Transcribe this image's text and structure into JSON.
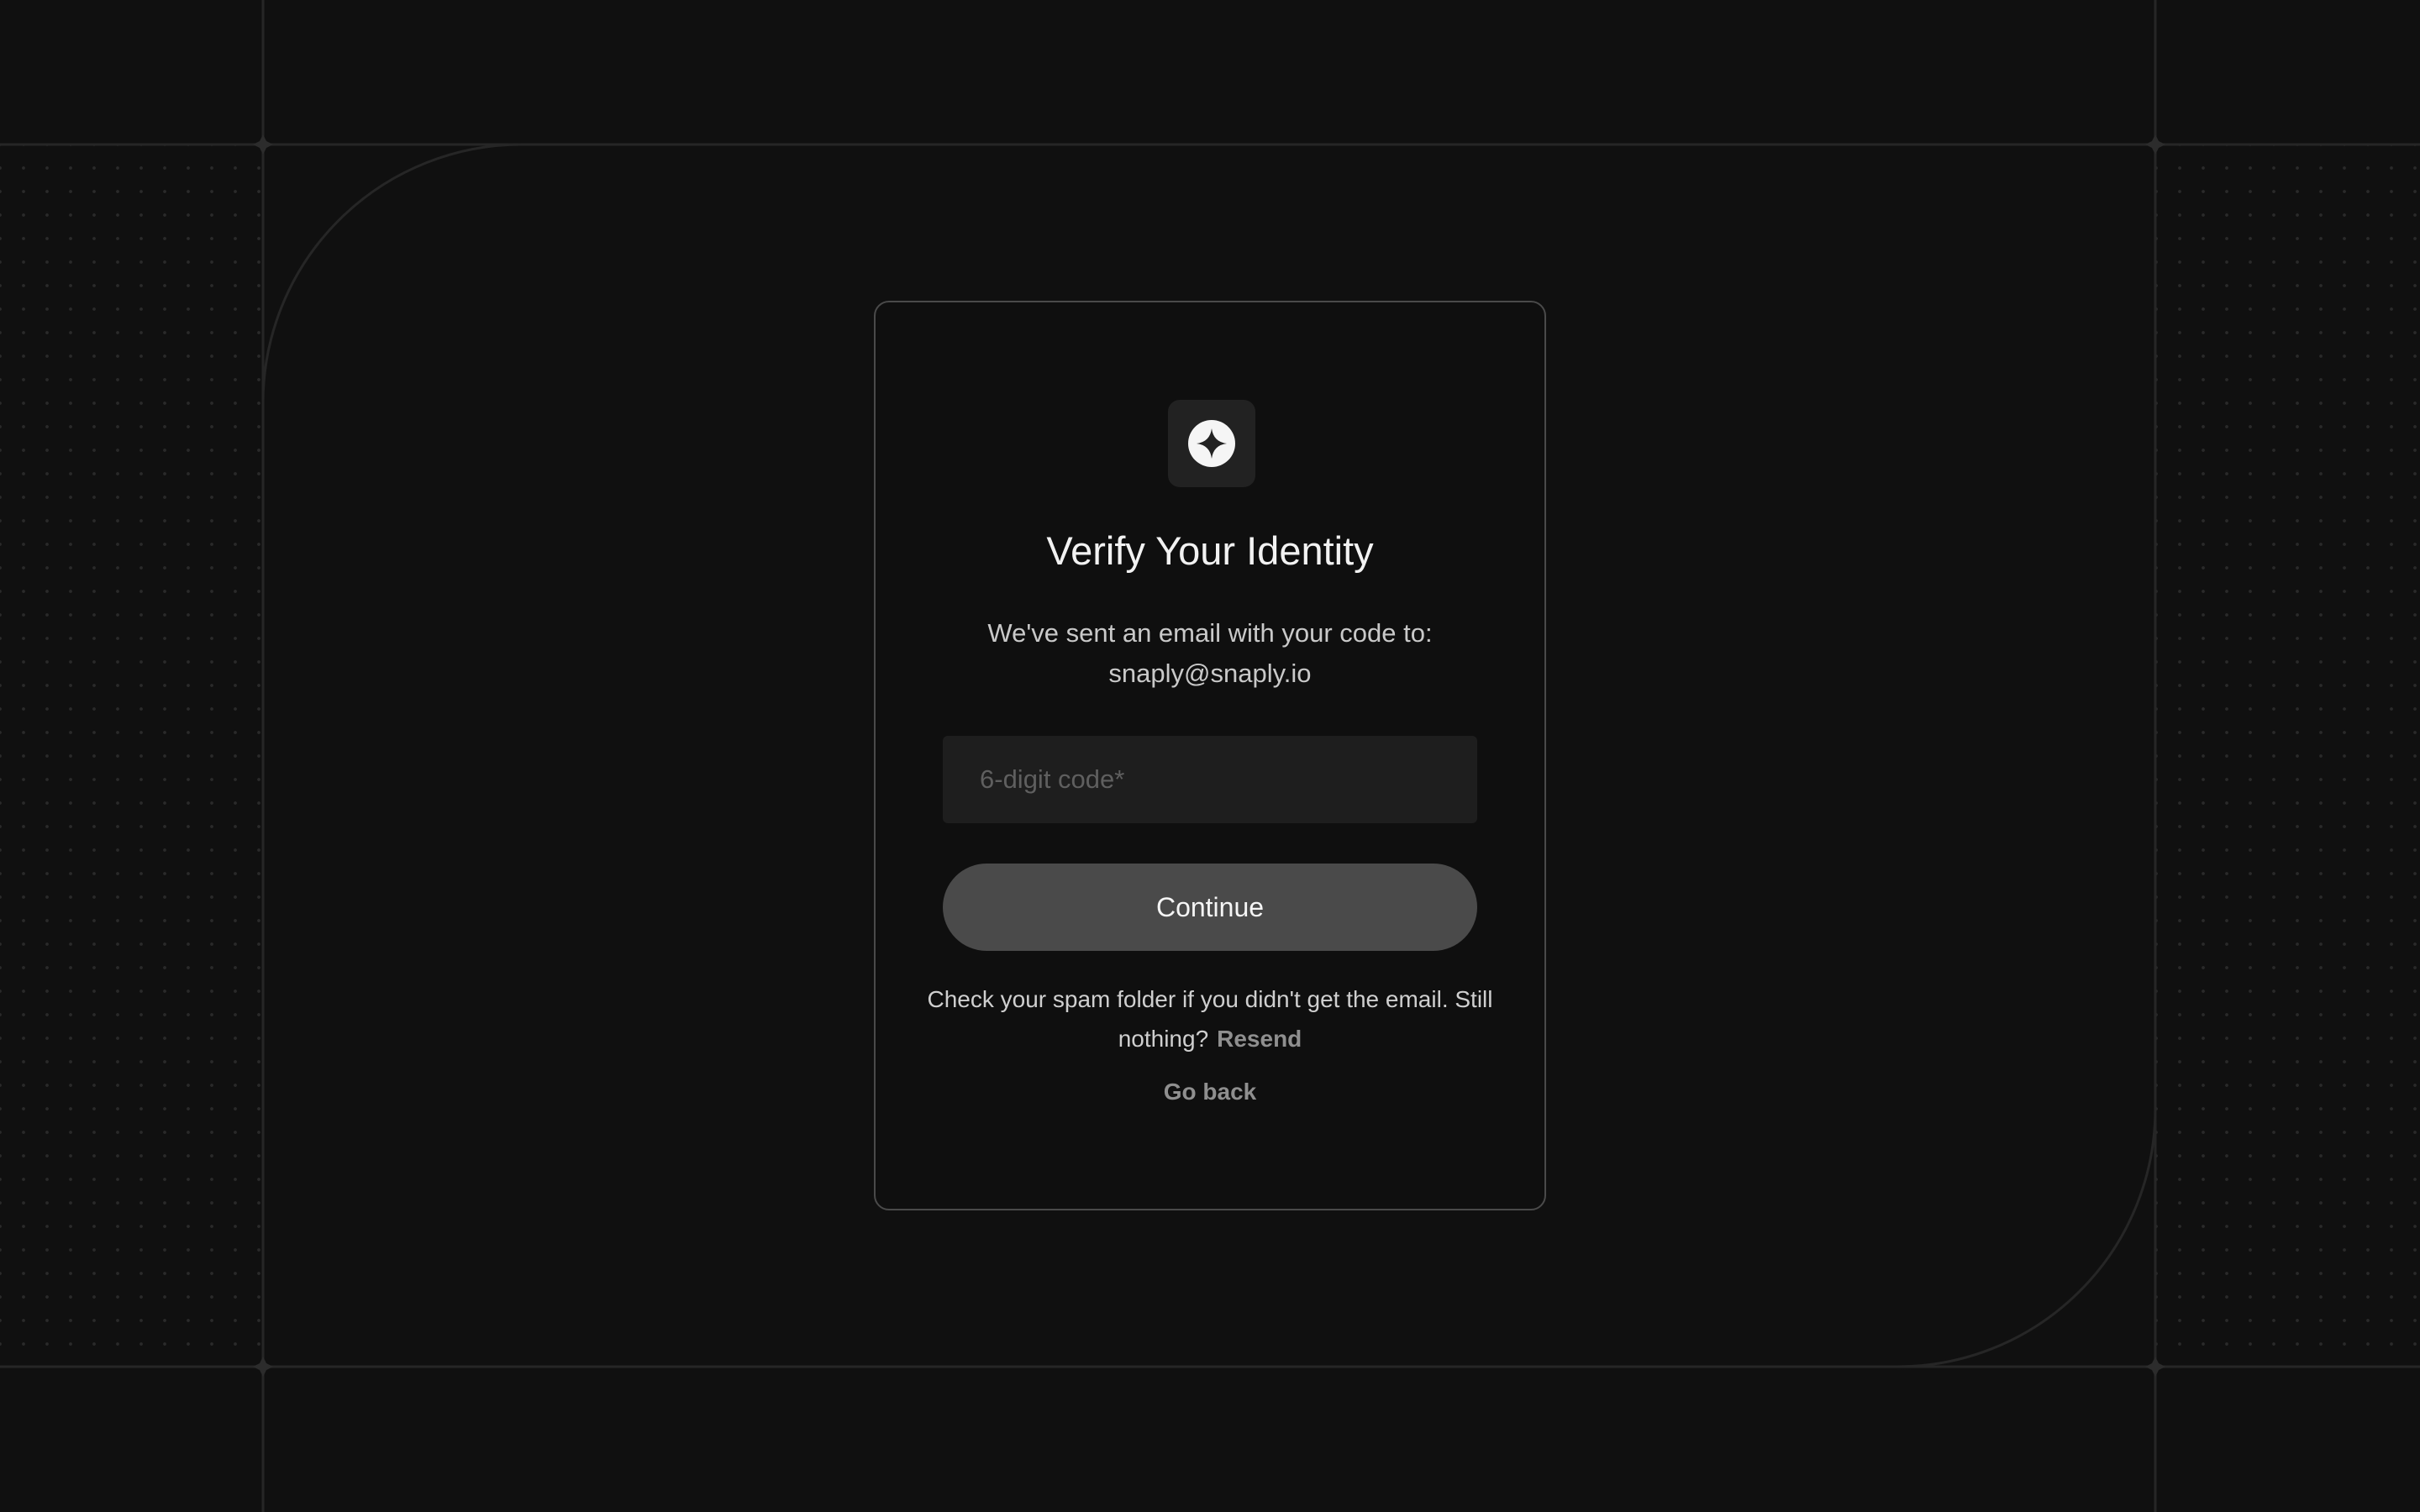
{
  "card": {
    "logo_icon": "four-point-star-icon",
    "title": "Verify Your Identity",
    "subtitle_line1": "We've sent an email with your code to:",
    "email": "snaply@snaply.io",
    "code_placeholder": "6-digit code*",
    "code_value": "",
    "continue_label": "Continue",
    "help_text": "Check your spam folder if you didn't get the email. Still nothing?",
    "resend_label": "Resend",
    "go_back_label": "Go back"
  },
  "colors": {
    "background": "#101010",
    "card_border": "#4a4a4a",
    "input_bg": "#1e1e1e",
    "button_bg": "#4a4a4a",
    "link": "#8f8f8f"
  }
}
